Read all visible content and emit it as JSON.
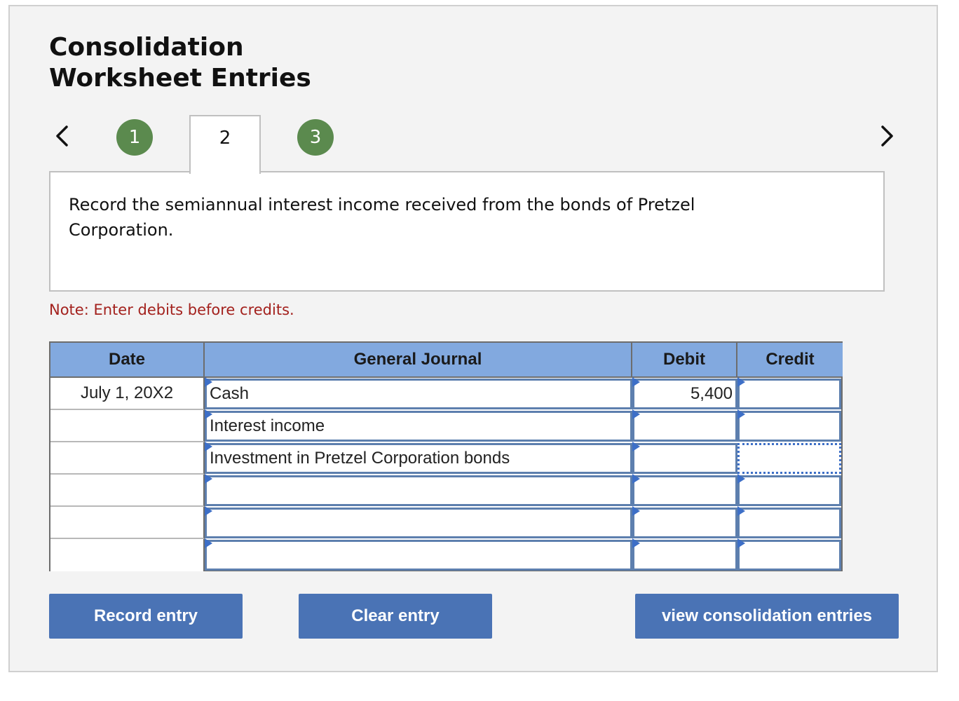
{
  "title": {
    "line1": "Consolidation",
    "line2": "Worksheet Entries"
  },
  "steps": [
    {
      "label": "1",
      "state": "complete"
    },
    {
      "label": "2",
      "state": "current"
    },
    {
      "label": "3",
      "state": "complete"
    }
  ],
  "nav": {
    "prev_icon": "chevron-left-icon",
    "next_icon": "chevron-right-icon"
  },
  "instruction": "Record the semiannual interest income received from the bonds of Pretzel Corporation.",
  "note": "Note: Enter debits before credits.",
  "journal": {
    "headers": {
      "date": "Date",
      "general_journal": "General Journal",
      "debit": "Debit",
      "credit": "Credit"
    },
    "rows": [
      {
        "date": "July 1, 20X2",
        "account": "Cash",
        "debit": "5,400",
        "credit": ""
      },
      {
        "date": "",
        "account": "Interest income",
        "debit": "",
        "credit": ""
      },
      {
        "date": "",
        "account": "Investment in Pretzel Corporation bonds",
        "debit": "",
        "credit": ""
      },
      {
        "date": "",
        "account": "",
        "debit": "",
        "credit": ""
      },
      {
        "date": "",
        "account": "",
        "debit": "",
        "credit": ""
      },
      {
        "date": "",
        "account": "",
        "debit": "",
        "credit": ""
      }
    ]
  },
  "buttons": {
    "record": "Record entry",
    "clear": "Clear entry",
    "view": "view consolidation entries"
  },
  "colors": {
    "step_complete": "#5b8a4e",
    "header_bg": "#82a9df",
    "button_bg": "#4a73b5",
    "note_text": "#a3211d",
    "cell_border": "#5d7fae"
  }
}
